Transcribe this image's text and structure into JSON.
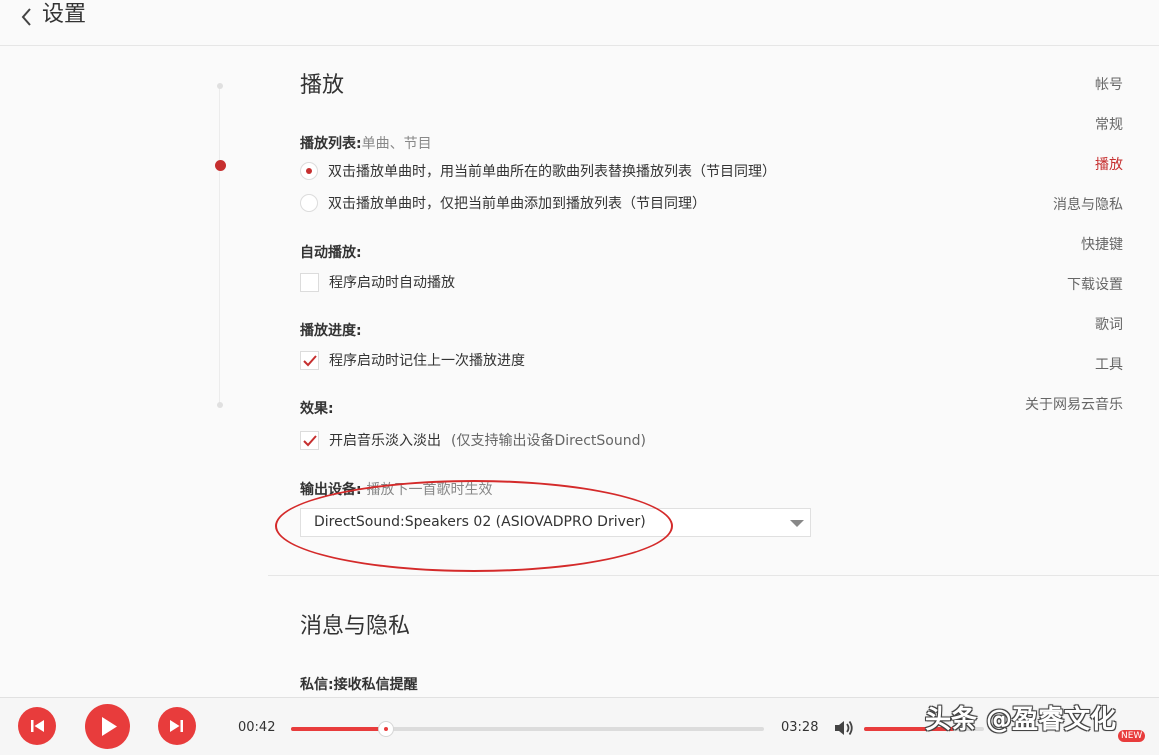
{
  "header": {
    "title": "设置"
  },
  "sidebar": {
    "items": [
      {
        "label": "帐号",
        "active": false
      },
      {
        "label": "常规",
        "active": false
      },
      {
        "label": "播放",
        "active": true
      },
      {
        "label": "消息与隐私",
        "active": false
      },
      {
        "label": "快捷键",
        "active": false
      },
      {
        "label": "下载设置",
        "active": false
      },
      {
        "label": "歌词",
        "active": false
      },
      {
        "label": "工具",
        "active": false
      },
      {
        "label": "关于网易云音乐",
        "active": false
      }
    ]
  },
  "playback": {
    "title": "播放",
    "playlist": {
      "label": "播放列表:",
      "hint": "单曲、节目",
      "options": [
        {
          "label": "双击播放单曲时，用当前单曲所在的歌曲列表替换播放列表（节目同理）",
          "checked": true
        },
        {
          "label": "双击播放单曲时，仅把当前单曲添加到播放列表（节目同理）",
          "checked": false
        }
      ]
    },
    "autoplay": {
      "label": "自动播放:",
      "option": "程序启动时自动播放",
      "checked": false
    },
    "progress": {
      "label": "播放进度:",
      "option": "程序启动时记住上一次播放进度",
      "checked": true
    },
    "effects": {
      "label": "效果:",
      "option": "开启音乐淡入淡出",
      "note": "(仅支持输出设备DirectSound)",
      "checked": true
    },
    "output": {
      "label": "输出设备:",
      "hint": "播放下一首歌时生效",
      "selected": "DirectSound:Speakers 02 (ASIOVADPRO Driver)"
    }
  },
  "privacy": {
    "title": "消息与隐私",
    "messages": {
      "label": "私信:",
      "hint": "接收私信提醒"
    }
  },
  "player": {
    "elapsed": "00:42",
    "duration": "03:28",
    "progress_fraction": 0.2,
    "volume_fraction": 0.75
  },
  "watermark": {
    "text": "头条 @盈睿文化",
    "badge": "NEW"
  },
  "colors": {
    "accent": "#c62f2f",
    "player_button": "#e83c3c",
    "annotation": "#d42a2a"
  }
}
